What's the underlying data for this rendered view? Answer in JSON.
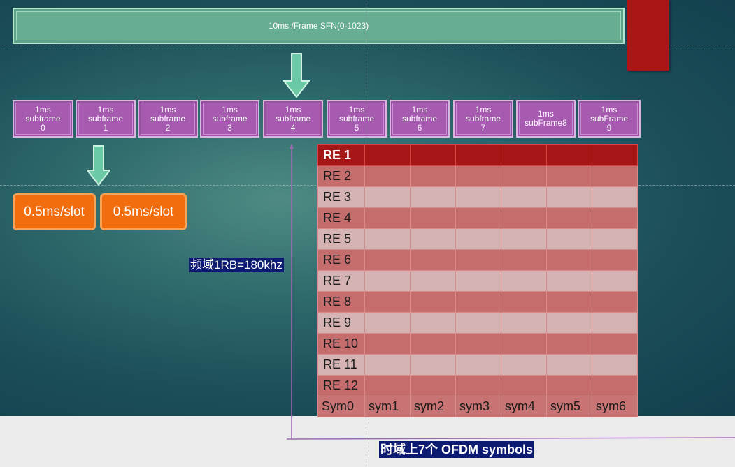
{
  "frame": {
    "label": "10ms /Frame  SFN(0-1023)"
  },
  "subframes": [
    {
      "label": "1ms\nsubframe\n0"
    },
    {
      "label": "1ms\nsubframe\n1"
    },
    {
      "label": "1ms\nsubframe\n2"
    },
    {
      "label": "1ms\nsubframe\n3"
    },
    {
      "label": "1ms\nsubframe\n4"
    },
    {
      "label": "1ms\nsubframe\n5"
    },
    {
      "label": "1ms\nsubframe\n6"
    },
    {
      "label": "1ms\nsubframe\n7"
    },
    {
      "label": "1ms\nsubFrame8"
    },
    {
      "label": "1ms\nsubFrame\n9"
    }
  ],
  "slots": [
    {
      "label": "0.5ms/slot"
    },
    {
      "label": "0.5ms/slot"
    }
  ],
  "freq_axis_label": "频域1RB=180khz",
  "time_axis_label": "时域上7个 OFDM symbols",
  "resource_elements": [
    "RE 1",
    "RE 2",
    "RE 3",
    "RE 4",
    "RE 5",
    "RE 6",
    "RE 7",
    "RE 8",
    "RE 9",
    "RE 10",
    "RE 11",
    "RE 12"
  ],
  "symbols": [
    "Sym0",
    "sym1",
    "sym2",
    "sym3",
    "sym4",
    "sym5",
    "sym6"
  ],
  "colors": {
    "frame_bar": "#66ad92",
    "subframe": "#a65ab0",
    "slot": "#f26d0d",
    "re_highlight": "#a51616",
    "label_bg": "#0c1a72",
    "axis_line": "#9b6bb0"
  }
}
